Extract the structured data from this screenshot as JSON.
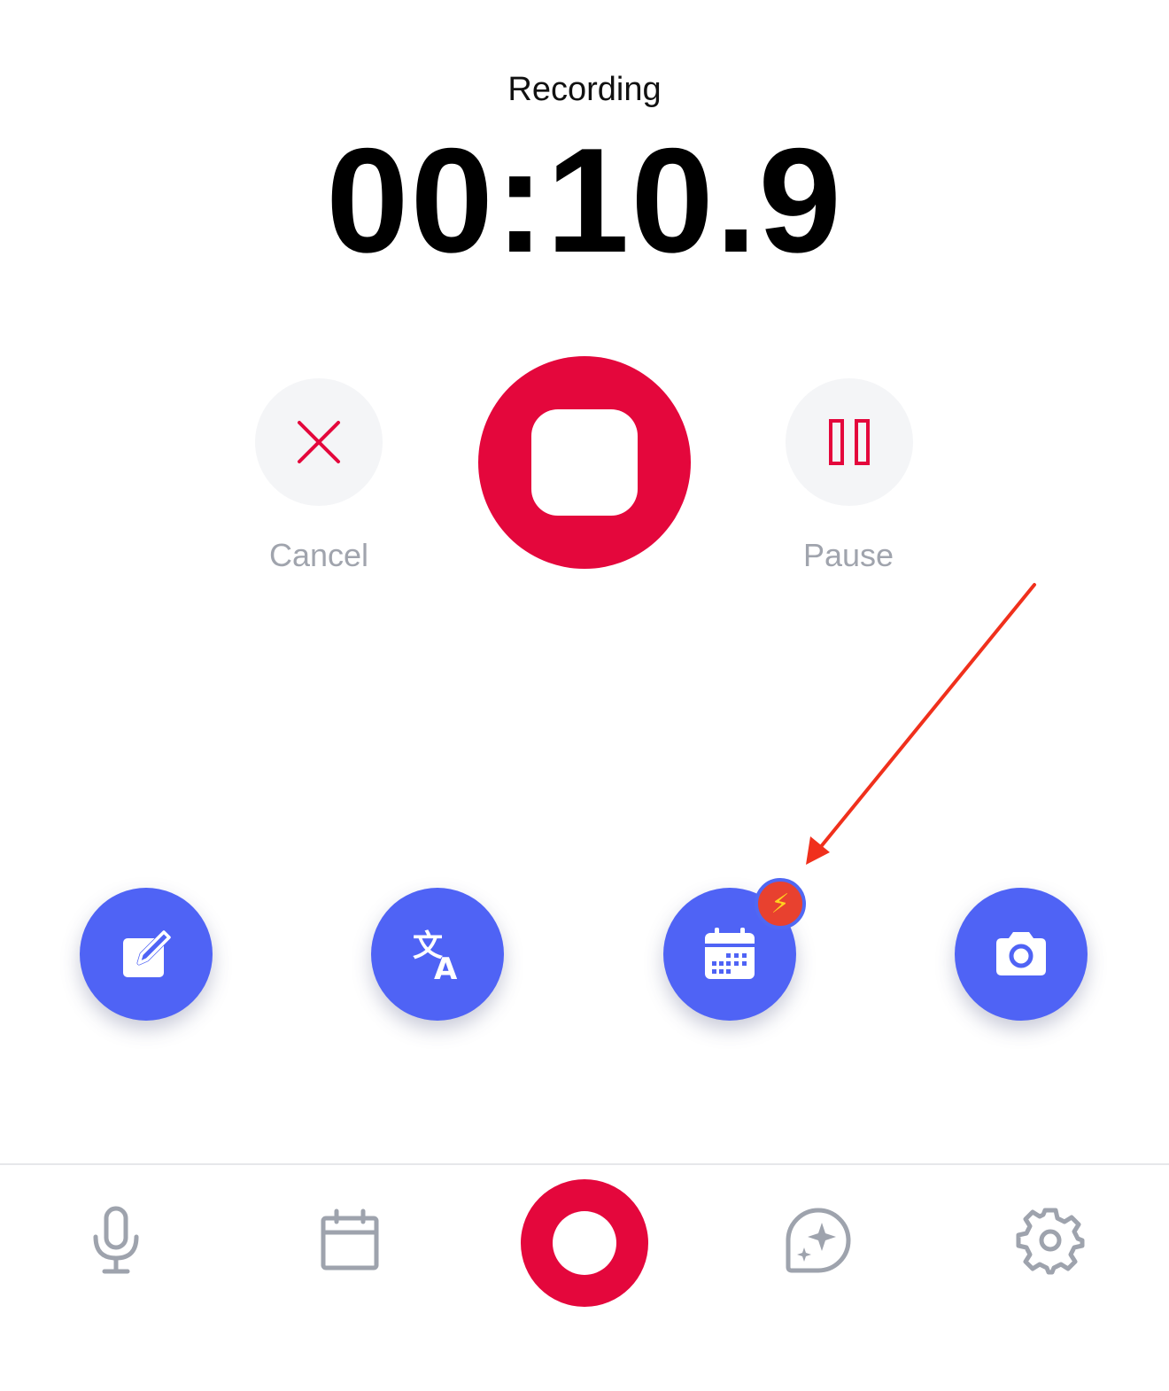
{
  "header": {
    "status": "Recording",
    "timer": "00:10.9"
  },
  "controls": {
    "cancel": {
      "label": "Cancel",
      "icon": "close-icon"
    },
    "stop": {
      "icon": "stop-icon"
    },
    "pause": {
      "label": "Pause",
      "icon": "pause-icon"
    }
  },
  "actions": [
    {
      "name": "note",
      "icon": "edit-note-icon"
    },
    {
      "name": "translate",
      "icon": "translate-icon"
    },
    {
      "name": "calendar",
      "icon": "calendar-icon",
      "badge": "⚡"
    },
    {
      "name": "camera",
      "icon": "camera-icon"
    }
  ],
  "tabbar": [
    {
      "name": "recordings",
      "icon": "microphone-icon"
    },
    {
      "name": "calendar",
      "icon": "calendar-icon"
    },
    {
      "name": "record",
      "icon": "record-icon"
    },
    {
      "name": "ai",
      "icon": "sparkle-chat-icon"
    },
    {
      "name": "settings",
      "icon": "gear-icon"
    }
  ],
  "colors": {
    "record_red": "#e4073c",
    "action_blue": "#4f63f5",
    "label_gray": "#a0a4ad",
    "annotation_arrow": "#f0301c",
    "badge_red": "#e8412f",
    "bolt_yellow": "#ffd21f",
    "tab_icon_gray": "#9ea3ad"
  }
}
